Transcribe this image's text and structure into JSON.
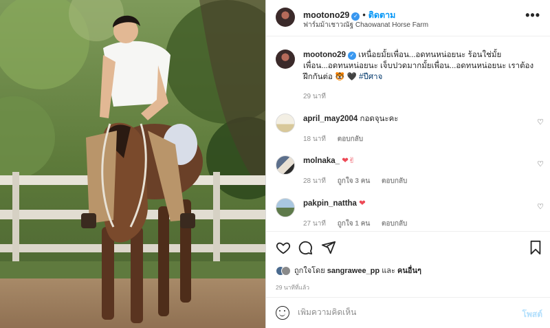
{
  "post": {
    "username": "mootono29",
    "follow_label": "ติดตาม",
    "location": "ฟาร์มม้าเชาวณัฐ Chaowanat Horse Farm",
    "more_label": "•••"
  },
  "caption": {
    "username": "mootono29",
    "text": "เหนื่อยมั้ยเพื่อน...อดทนหน่อยนะ ร้อนใช่มั้ยเพื่อน...อดทนหน่อยนะ เจ็บปวดมากมั้ยเพื่อน...อดทนหน่อยนะ เราต้องฝึกกันต่อ 🐯 🖤",
    "hashtag": "#ปีศาจ",
    "time": "29 นาที"
  },
  "comments": [
    {
      "username": "april_may2004",
      "text": "กอดจุนะคะ",
      "emoji": "",
      "time": "18 นาที",
      "likes": "",
      "reply": "ตอบกลับ"
    },
    {
      "username": "molnaka_",
      "text": "",
      "emoji": "❤✌",
      "time": "28 นาที",
      "likes": "ถูกใจ 3 คน",
      "reply": "ตอบกลับ"
    },
    {
      "username": "pakpin_nattha",
      "text": "",
      "emoji": "❤",
      "time": "27 นาที",
      "likes": "ถูกใจ 1 คน",
      "reply": "ตอบกลับ"
    }
  ],
  "actions": {
    "liked_prefix": "ถูกใจโดย",
    "liked_user": "sangrawee_pp",
    "liked_and": "และ",
    "liked_others": "คนอื่นๆ",
    "time_ago": "29 นาทีที่แล้ว"
  },
  "add_comment": {
    "placeholder": "เพิ่มความคิดเห็น",
    "post_label": "โพสต์"
  },
  "icons": {
    "heart": "heart-icon",
    "comment": "comment-icon",
    "share": "share-icon",
    "save": "bookmark-icon",
    "emoji": "emoji-icon",
    "more": "more-icon"
  },
  "colors": {
    "accent": "#0095f6",
    "verified": "#3897f0",
    "heart_red": "#ed4956",
    "post_disabled": "#b2dffc"
  }
}
